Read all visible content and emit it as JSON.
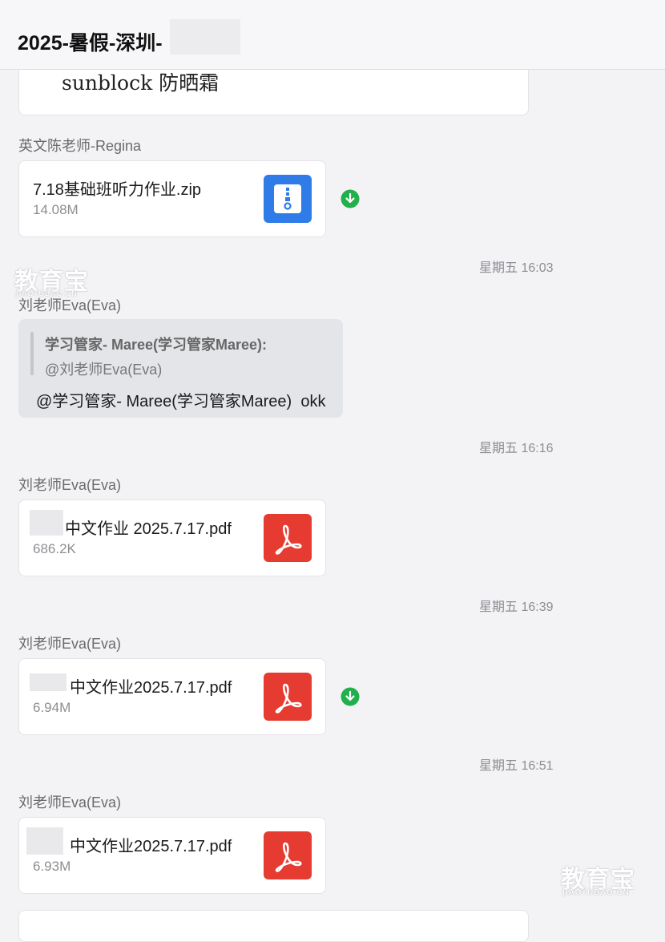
{
  "header": {
    "title": "2025-暑假-深圳-"
  },
  "previous_message": {
    "text": "sunblock 防晒霜"
  },
  "messages": [
    {
      "sender": "英文陈老师-Regina",
      "file": {
        "name": "7.18基础班听力作业.zip",
        "size": "14.08M",
        "type_icon": "zip-file-icon"
      },
      "download_icon": "download-done-icon"
    },
    {
      "timestamp": "星期五 16:03",
      "sender": "刘老师Eva(Eva)",
      "quote": {
        "author": "学习管家- Maree(学习管家Maree):",
        "text": "@刘老师Eva(Eva)"
      },
      "reply": "@学习管家- Maree(学习管家Maree)  okk"
    },
    {
      "timestamp": "星期五 16:16",
      "sender": "刘老师Eva(Eva)",
      "file": {
        "name": "中文作业 2025.7.17.pdf",
        "size": "686.2K",
        "type_icon": "pdf-file-icon"
      }
    },
    {
      "timestamp": "星期五 16:39",
      "sender": "刘老师Eva(Eva)",
      "file": {
        "name": "中文作业2025.7.17.pdf",
        "size": "6.94M",
        "type_icon": "pdf-file-icon"
      },
      "download_icon": "download-done-icon"
    },
    {
      "timestamp": "星期五 16:51",
      "sender": "刘老师Eva(Eva)",
      "file": {
        "name": "中文作业2025.7.17.pdf",
        "size": "6.93M",
        "type_icon": "pdf-file-icon"
      }
    }
  ],
  "watermark": {
    "main": "教育宝",
    "sub": "JIAOYUBAO.CN"
  },
  "colors": {
    "background": "#f3f3f6",
    "zip_icon": "#2f7ce8",
    "pdf_icon": "#e63b31",
    "download_icon": "#21b04b",
    "quote_bubble": "#e3e5e9"
  }
}
